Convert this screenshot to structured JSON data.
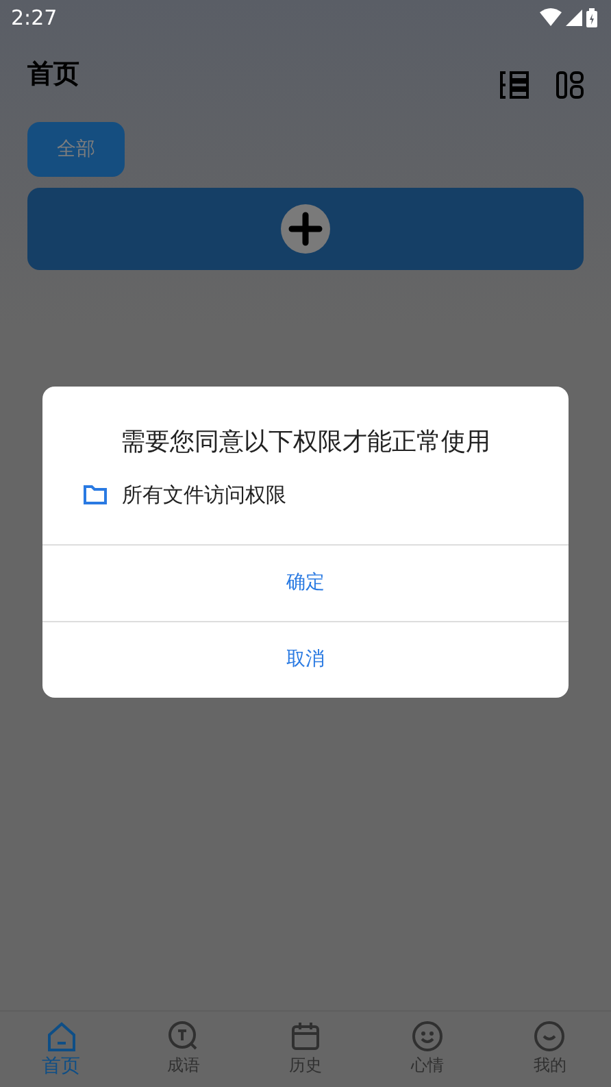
{
  "status_bar": {
    "time": "2:27"
  },
  "header": {
    "title": "首页"
  },
  "filters": [
    {
      "label": "全部",
      "selected": true
    }
  ],
  "dialog": {
    "title": "需要您同意以下权限才能正常使用",
    "permissions": [
      {
        "label": "所有文件访问权限"
      }
    ],
    "buttons": [
      "确定",
      "取消"
    ]
  },
  "bottom_nav": [
    {
      "label": "首页",
      "selected": true
    },
    {
      "label": "成语",
      "selected": false
    },
    {
      "label": "历史",
      "selected": false
    },
    {
      "label": "心情",
      "selected": false
    },
    {
      "label": "我的",
      "selected": false
    }
  ]
}
